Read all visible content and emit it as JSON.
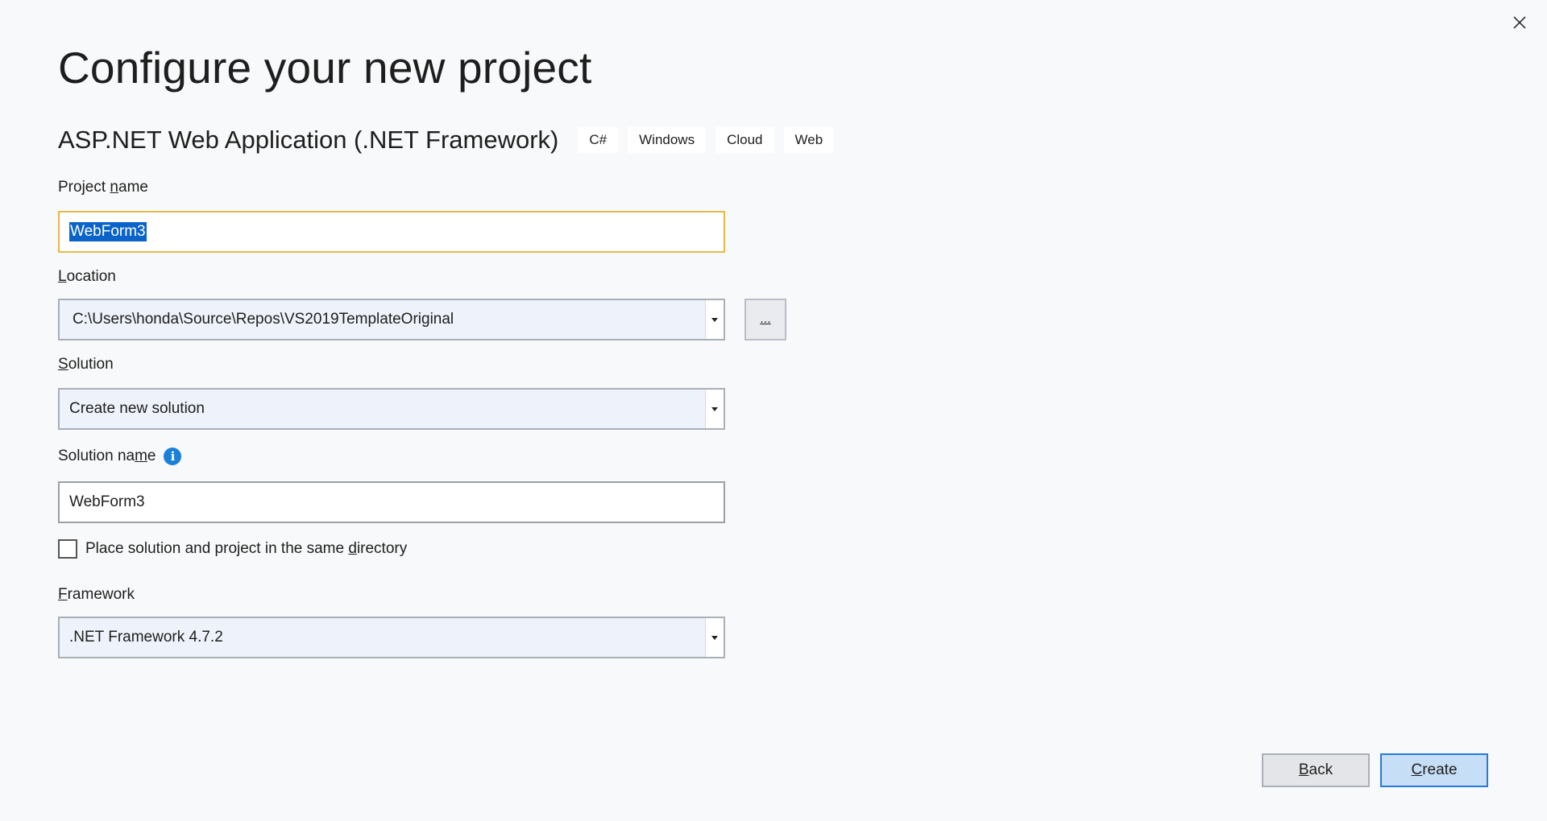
{
  "dialog": {
    "title": "Configure your new project",
    "close_icon": "close-icon"
  },
  "template": {
    "name": "ASP.NET Web Application (.NET Framework)",
    "tags": [
      "C#",
      "Windows",
      "Cloud",
      "Web"
    ]
  },
  "project_name": {
    "label_pre": "Project ",
    "label_key": "n",
    "label_post": "ame",
    "value": "WebForm3"
  },
  "location": {
    "label_key": "L",
    "label_post": "ocation",
    "value": "C:\\Users\\honda\\Source\\Repos\\VS2019TemplateOriginal",
    "browse_label": "..."
  },
  "solution": {
    "label_key": "S",
    "label_post": "olution",
    "value": "Create new solution"
  },
  "solution_name": {
    "label_pre": "Solution na",
    "label_key": "m",
    "label_post": "e",
    "info_glyph": "i",
    "value": "WebForm3"
  },
  "same_directory": {
    "label_pre": "Place solution and project in the same ",
    "label_key": "d",
    "label_post": "irectory",
    "checked": false
  },
  "framework": {
    "label_key": "F",
    "label_post": "ramework",
    "value": ".NET Framework 4.7.2"
  },
  "buttons": {
    "back_key": "B",
    "back_post": "ack",
    "create_key": "C",
    "create_post": "reate"
  }
}
